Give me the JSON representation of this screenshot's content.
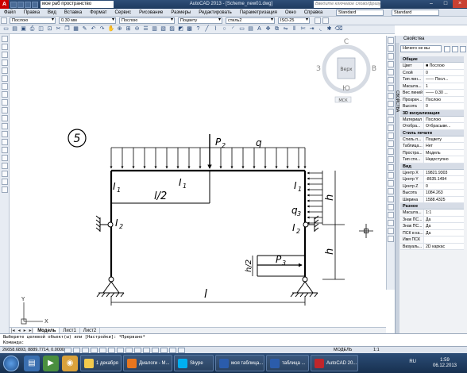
{
  "titlebar": {
    "logo": "A",
    "workspace": "мое раб пространство",
    "title": "AutoCAD 2013 - [Scheme_new01.dwg]",
    "search_placeholder": "Введите ключевое слово/фразу"
  },
  "menu": [
    "Файл",
    "Правка",
    "Вид",
    "Вставка",
    "Формат",
    "Сервис",
    "Рисование",
    "Размеры",
    "Редактировать",
    "Параметризация",
    "Окно",
    "Справка"
  ],
  "menu_combos": {
    "text_style": "Standard",
    "dim_style": "Standard"
  },
  "toolbar1": {
    "layer": "Послою",
    "lineweight": "0.30 мм",
    "linetype": "Послою",
    "plotstyle": "Поцвету",
    "material": "стиль2",
    "iso": "ISO-25"
  },
  "viewcube": {
    "north": "С",
    "south": "Ю",
    "west": "З",
    "east": "В",
    "face": "Верх",
    "wcs": "МСК"
  },
  "drawing": {
    "panel_number": "5",
    "labels": {
      "P2": "P",
      "P2_sub": "2",
      "q": "q",
      "I1_left": "I",
      "I1_left_sub": "1",
      "I1_top": "I",
      "I1_top_sub": "1",
      "I1_right": "I",
      "I1_right_sub": "1",
      "I2_left": "I",
      "I2_left_sub": "2",
      "I2_right": "I",
      "I2_right_sub": "2",
      "q3": "q",
      "q3_sub": "3",
      "P3": "P",
      "P3_sub": "3",
      "half_l": "l/2",
      "half_h": "h/2",
      "h_top": "h",
      "h_bottom": "h",
      "l": "l"
    },
    "ucs_y": "Y",
    "ucs_x": "X"
  },
  "tabs": {
    "items": [
      "Модель",
      "Лист1",
      "Лист2"
    ],
    "active": "Модель"
  },
  "properties": {
    "title": "Свойства",
    "selection": "Ничего не вы",
    "side_label": "СВОЙСТВА",
    "sections": [
      {
        "name": "Общие",
        "rows": [
          {
            "k": "Цвет",
            "v": "■ Послою"
          },
          {
            "k": "Слой",
            "v": "0"
          },
          {
            "k": "Тип лин...",
            "v": "—— Посл..."
          },
          {
            "k": "Масшта...",
            "v": "1"
          },
          {
            "k": "Вес линий",
            "v": "—— 0.30 ..."
          },
          {
            "k": "Прозрач...",
            "v": "Послою"
          },
          {
            "k": "Высота",
            "v": "0"
          }
        ]
      },
      {
        "name": "3D визуализация",
        "rows": [
          {
            "k": "Материал",
            "v": "Послою"
          },
          {
            "k": "Отобра...",
            "v": "Отбрасыве..."
          }
        ]
      },
      {
        "name": "Стиль печати",
        "rows": [
          {
            "k": "Стиль п...",
            "v": "Поцвету"
          },
          {
            "k": "Таблица...",
            "v": "Нет"
          },
          {
            "k": "Простра...",
            "v": "Модель"
          },
          {
            "k": "Тип сти...",
            "v": "Недоступно"
          }
        ]
      },
      {
        "name": "Вид",
        "rows": [
          {
            "k": "Центр X",
            "v": "19821.9303"
          },
          {
            "k": "Центр Y",
            "v": "-8635.1494"
          },
          {
            "k": "Центр Z",
            "v": "0"
          },
          {
            "k": "Высота",
            "v": "1084.263"
          },
          {
            "k": "Ширина",
            "v": "1588.4325"
          }
        ]
      },
      {
        "name": "Разное",
        "rows": [
          {
            "k": "Масшта...",
            "v": "1:1"
          },
          {
            "k": "Знак ПС...",
            "v": "Да"
          },
          {
            "k": "Знак ПС...",
            "v": "Да"
          },
          {
            "k": "ПСК в ка...",
            "v": "Да"
          },
          {
            "k": "Имя ПСК",
            "v": ""
          },
          {
            "k": "Визуаль...",
            "v": "2D каркас"
          }
        ]
      }
    ]
  },
  "command": {
    "line1": "Выберите целевой объект(ы) или [Настройки]: *Прервано*",
    "line2": "Команда:"
  },
  "status": {
    "coords": "26658.6893, 8889.7714, 0.0000",
    "model": "МОДЕЛЬ",
    "scale": "1:1"
  },
  "taskbar": {
    "tasks": [
      {
        "label": "1 декабря",
        "color": "#f2c94c"
      },
      {
        "label": "Диалоги - M...",
        "color": "#e8761e"
      },
      {
        "label": "Skype",
        "color": "#00aff0"
      },
      {
        "label": "моя таблица...",
        "color": "#2b5cab"
      },
      {
        "label": "таблица ...",
        "color": "#2b5cab"
      },
      {
        "label": "AutoCAD 20...",
        "color": "#c0262b"
      }
    ],
    "lang": "RU",
    "time": "1:59",
    "date": "06.12.2013"
  }
}
